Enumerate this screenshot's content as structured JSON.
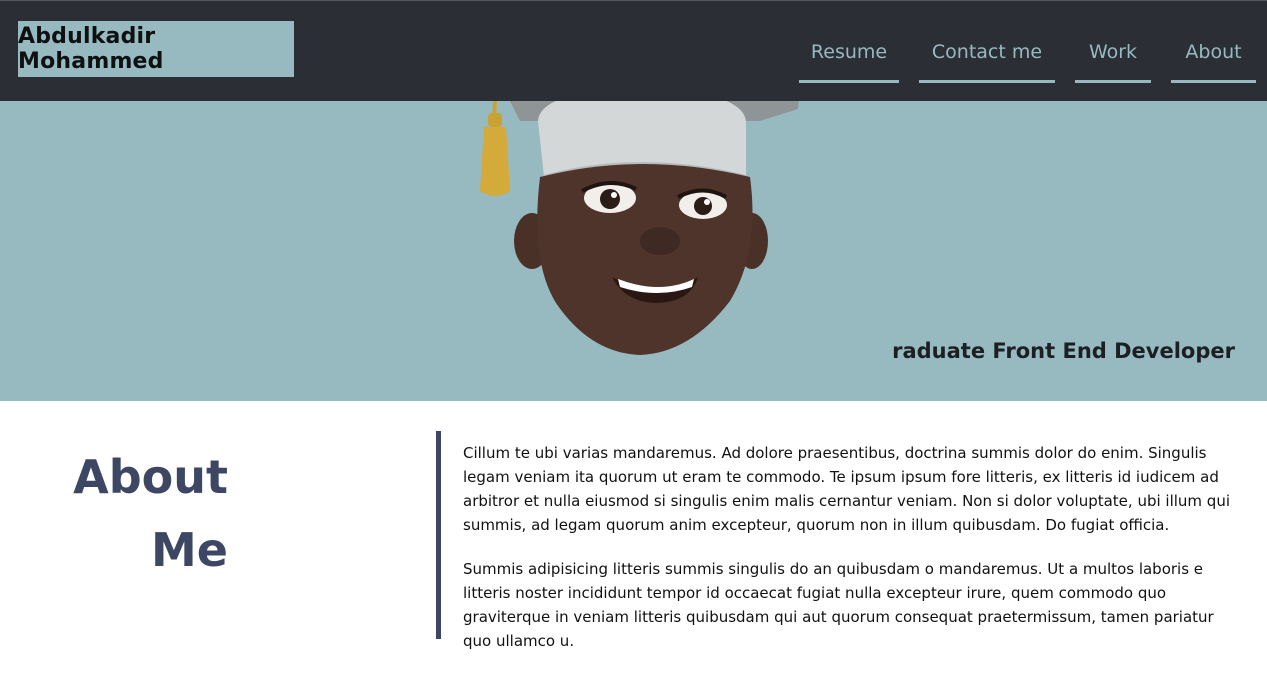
{
  "header": {
    "brand": "Abdulkadir Mohammed",
    "nav": [
      {
        "label": "Resume"
      },
      {
        "label": "Contact me"
      },
      {
        "label": "Work"
      },
      {
        "label": "About"
      }
    ]
  },
  "hero": {
    "tagline": "raduate Front End Developer"
  },
  "about": {
    "title_line1": "About",
    "title_line2": "Me",
    "paragraphs": [
      "Cillum te ubi varias mandaremus. Ad dolore praesentibus, doctrina summis dolor do enim. Singulis legam veniam ita quorum ut eram te commodo. Te ipsum ipsum fore litteris, ex litteris id iudicem ad arbitror et nulla eiusmod si singulis enim malis cernantur veniam. Non si dolor voluptate, ubi illum qui summis, ad legam quorum anim excepteur, quorum non in illum quibusdam. Do fugiat officia.",
      "Summis adipisicing litteris summis singulis do an quibusdam o mandaremus. Ut a multos laboris e litteris noster incididunt tempor id occaecat fugiat nulla excepteur irure, quem commodo quo graviterque in veniam litteris quibusdam qui aut quorum consequat praetermissum, tamen pariatur quo ullamco u."
    ]
  },
  "colors": {
    "header_bg": "#2b2e35",
    "accent": "#96bac0",
    "heading": "#3d4764"
  }
}
